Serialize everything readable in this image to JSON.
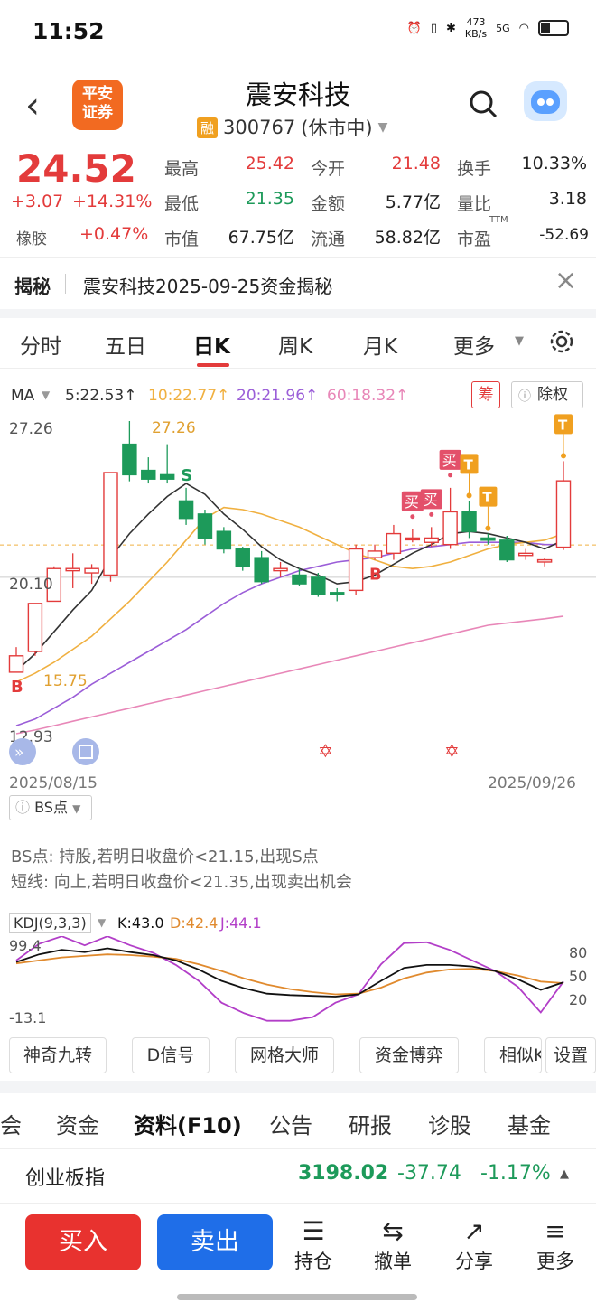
{
  "status": {
    "time": "11:52",
    "net_speed": "473",
    "net_unit": "KB/s",
    "signal": "5G"
  },
  "header": {
    "logo_line1": "平安",
    "logo_line2": "证券",
    "stock_name": "震安科技",
    "rong_badge": "融",
    "stock_code": "300767",
    "market_state": "(休市中)"
  },
  "quote": {
    "price": "24.52",
    "change": "+3.07",
    "change_pct": "+14.31%",
    "sector_name": "橡胶",
    "sector_pct": "+0.47%",
    "high_label": "最高",
    "high": "25.42",
    "low_label": "最低",
    "low": "21.35",
    "mcap_label": "市值",
    "mcap": "67.75亿",
    "open_label": "今开",
    "open": "21.48",
    "amount_label": "金额",
    "amount": "5.77亿",
    "float_label": "流通",
    "float": "58.82亿",
    "turnover_label": "换手",
    "turnover": "10.33%",
    "vol_ratio_label": "量比",
    "vol_ratio": "3.18",
    "pe_label": "市盈",
    "pe_sup": "TTM",
    "pe": "-52.69"
  },
  "banner": {
    "tag": "揭秘",
    "text": "震安科技2025-09-25资金揭秘"
  },
  "tabs": [
    "分时",
    "五日",
    "日K",
    "周K",
    "月K",
    "更多"
  ],
  "ma": {
    "label": "MA",
    "ma5": "5:22.53↑",
    "ma10": "10:22.77↑",
    "ma20": "20:21.96↑",
    "ma60": "60:18.32↑",
    "chip_btn": "筹",
    "exright_btn": "除权"
  },
  "colors": {
    "up": "#e33b3b",
    "down": "#1d9a5a",
    "ma5": "#333333",
    "ma10": "#f0b040",
    "ma20": "#9b5ed8",
    "ma60": "#e887b8",
    "kdj_k": "#111111",
    "kdj_d": "#e08a2e",
    "kdj_j": "#b23ec8"
  },
  "chart_labels": {
    "ymax": "27.26",
    "ymid": "20.10",
    "ymin": "12.93",
    "high_note": "27.26",
    "low_note": "15.75",
    "date_start": "2025/08/15",
    "date_end": "2025/09/26"
  },
  "chart_data": {
    "type": "candlestick",
    "ylim": [
      12.93,
      27.26
    ],
    "candles": [
      {
        "o": 15.75,
        "c": 16.5,
        "h": 16.9,
        "l": 15.75
      },
      {
        "o": 16.7,
        "c": 18.9,
        "h": 18.9,
        "l": 16.5
      },
      {
        "o": 19.0,
        "c": 20.5,
        "h": 20.6,
        "l": 19.0
      },
      {
        "o": 20.4,
        "c": 20.5,
        "h": 21.2,
        "l": 19.6
      },
      {
        "o": 20.3,
        "c": 20.5,
        "h": 20.7,
        "l": 19.8
      },
      {
        "o": 20.2,
        "c": 24.9,
        "h": 24.9,
        "l": 19.9
      },
      {
        "o": 26.2,
        "c": 24.8,
        "h": 27.26,
        "l": 24.5
      },
      {
        "o": 25.0,
        "c": 24.6,
        "h": 25.6,
        "l": 24.4
      },
      {
        "o": 24.8,
        "c": 24.6,
        "h": 26.2,
        "l": 24.4
      },
      {
        "o": 23.6,
        "c": 22.8,
        "h": 24.2,
        "l": 22.5
      },
      {
        "o": 23.0,
        "c": 21.9,
        "h": 23.2,
        "l": 21.6
      },
      {
        "o": 22.2,
        "c": 21.4,
        "h": 22.4,
        "l": 21.2
      },
      {
        "o": 21.4,
        "c": 20.6,
        "h": 21.5,
        "l": 20.4
      },
      {
        "o": 21.0,
        "c": 19.9,
        "h": 21.3,
        "l": 19.8
      },
      {
        "o": 20.4,
        "c": 20.5,
        "h": 20.8,
        "l": 20.1
      },
      {
        "o": 20.2,
        "c": 19.8,
        "h": 20.5,
        "l": 19.7
      },
      {
        "o": 20.1,
        "c": 19.3,
        "h": 20.3,
        "l": 19.2
      },
      {
        "o": 19.4,
        "c": 19.3,
        "h": 19.6,
        "l": 19.0
      },
      {
        "o": 19.5,
        "c": 21.4,
        "h": 21.6,
        "l": 19.3
      },
      {
        "o": 21.0,
        "c": 21.3,
        "h": 21.6,
        "l": 20.9
      },
      {
        "o": 21.2,
        "c": 22.1,
        "h": 22.5,
        "l": 20.9
      },
      {
        "o": 21.9,
        "c": 21.9,
        "h": 22.3,
        "l": 21.7
      },
      {
        "o": 21.7,
        "c": 21.9,
        "h": 22.4,
        "l": 21.5
      },
      {
        "o": 21.6,
        "c": 23.1,
        "h": 24.2,
        "l": 21.4
      },
      {
        "o": 23.1,
        "c": 22.2,
        "h": 23.6,
        "l": 21.9
      },
      {
        "o": 21.9,
        "c": 21.8,
        "h": 22.1,
        "l": 21.6
      },
      {
        "o": 21.8,
        "c": 20.9,
        "h": 22.0,
        "l": 20.8
      },
      {
        "o": 21.1,
        "c": 21.2,
        "h": 21.4,
        "l": 20.9
      },
      {
        "o": 20.8,
        "c": 20.9,
        "h": 21.0,
        "l": 20.6
      },
      {
        "o": 21.48,
        "c": 24.52,
        "h": 25.42,
        "l": 21.35
      }
    ],
    "ma5": [
      15.8,
      16.6,
      17.6,
      18.6,
      19.5,
      21.0,
      22.1,
      23.0,
      23.8,
      24.4,
      23.9,
      23.0,
      22.3,
      21.5,
      20.9,
      20.5,
      20.2,
      19.8,
      19.9,
      20.2,
      20.7,
      21.2,
      21.6,
      22.1,
      22.2,
      22.1,
      21.9,
      21.7,
      21.4,
      21.8
    ],
    "ma10": [
      15.3,
      15.7,
      16.2,
      16.8,
      17.4,
      18.2,
      19.0,
      19.9,
      20.8,
      21.8,
      22.8,
      23.3,
      23.2,
      23.0,
      22.7,
      22.4,
      22.0,
      21.6,
      21.2,
      20.9,
      20.6,
      20.5,
      20.6,
      20.8,
      21.1,
      21.4,
      21.6,
      21.7,
      21.8,
      22.1
    ],
    "ma20": [
      13.3,
      13.6,
      14.1,
      14.6,
      15.2,
      15.7,
      16.2,
      16.7,
      17.2,
      17.7,
      18.3,
      18.9,
      19.4,
      19.8,
      20.1,
      20.4,
      20.6,
      20.8,
      20.9,
      21.0,
      21.2,
      21.4,
      21.5,
      21.6,
      21.7,
      21.7,
      21.7,
      21.7,
      21.6,
      21.6
    ],
    "ma60": [
      12.93,
      13.1,
      13.3,
      13.5,
      13.7,
      13.9,
      14.1,
      14.3,
      14.5,
      14.7,
      14.9,
      15.1,
      15.3,
      15.5,
      15.7,
      15.9,
      16.1,
      16.3,
      16.5,
      16.7,
      16.9,
      17.1,
      17.3,
      17.5,
      17.7,
      17.9,
      18.0,
      18.1,
      18.2,
      18.32
    ],
    "signals": [
      {
        "i": 0,
        "text": "B",
        "type": "B"
      },
      {
        "i": 9,
        "text": "S",
        "type": "S"
      },
      {
        "i": 19,
        "text": "B",
        "type": "B"
      },
      {
        "i": 21,
        "text": "买",
        "type": "buy"
      },
      {
        "i": 22,
        "text": "买",
        "type": "buy"
      },
      {
        "i": 23,
        "text": "买",
        "type": "buy"
      },
      {
        "i": 24,
        "text": "T",
        "type": "T"
      },
      {
        "i": 25,
        "text": "T",
        "type": "T"
      },
      {
        "i": 29,
        "text": "T",
        "type": "T"
      }
    ]
  },
  "bs": {
    "dropdown": "BS点",
    "line1": "BS点: 持股,若明日收盘价<21.15,出现S点",
    "line2": "短线: 向上,若明日收盘价<21.35,出现卖出机会"
  },
  "kdj": {
    "label": "KDJ(9,3,3)",
    "k": "K:43.0",
    "d": "D:42.4",
    "j": "J:44.1",
    "ymax": "99.4",
    "ymin": "-13.1",
    "lvl80": "80",
    "lvl50": "50",
    "lvl20": "20",
    "k_values": [
      70,
      80,
      86,
      83,
      88,
      83,
      79,
      72,
      60,
      45,
      35,
      28,
      26,
      25,
      24,
      27,
      45,
      62,
      66,
      66,
      64,
      58,
      47,
      33,
      43
    ],
    "d_values": [
      68,
      72,
      76,
      78,
      80,
      79,
      77,
      74,
      67,
      58,
      48,
      40,
      34,
      30,
      27,
      28,
      36,
      48,
      56,
      60,
      61,
      58,
      52,
      44,
      42
    ],
    "j_values": [
      72,
      94,
      104,
      92,
      104,
      92,
      82,
      66,
      45,
      16,
      2,
      -8,
      -8,
      -3,
      16,
      27,
      67,
      95,
      96,
      86,
      72,
      58,
      37,
      3,
      44
    ]
  },
  "tool_buttons": [
    "神奇九转",
    "D信号",
    "网格大师",
    "资金博弈",
    "相似K",
    "设置"
  ],
  "bottom_tabs": [
    "会",
    "资金",
    "资料(F10)",
    "公告",
    "研报",
    "诊股",
    "基金"
  ],
  "index": {
    "name": "创业板指",
    "value": "3198.02",
    "change": "-37.74",
    "pct": "-1.17%"
  },
  "actions": {
    "buy": "买入",
    "sell": "卖出",
    "hold": "持仓",
    "cancel": "撤单",
    "share": "分享",
    "more": "更多"
  }
}
